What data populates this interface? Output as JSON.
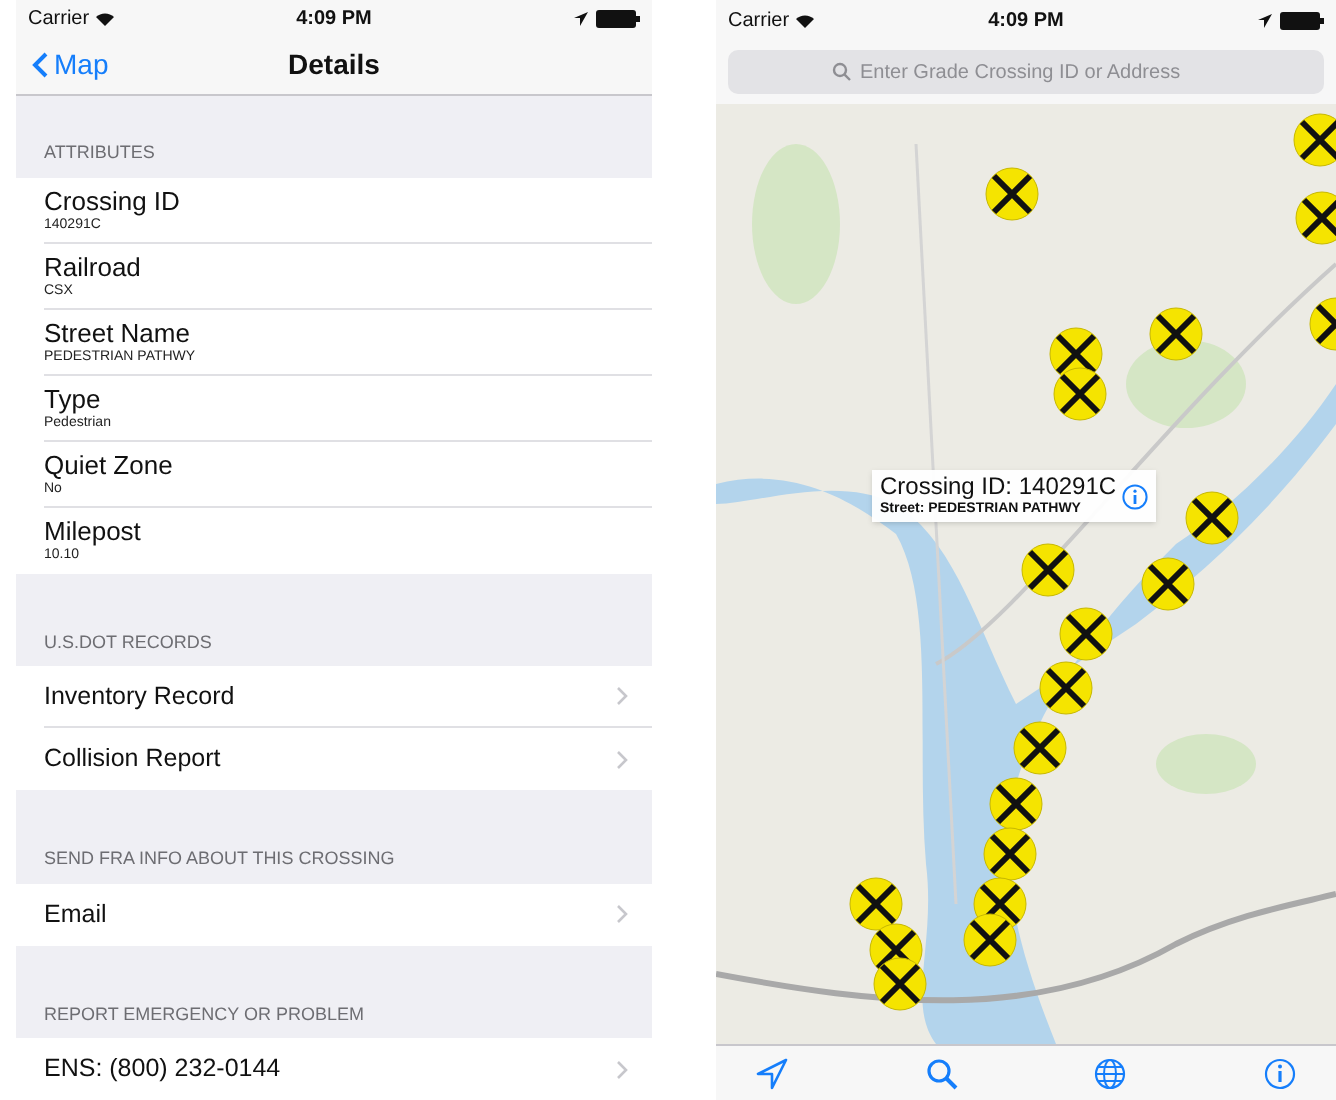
{
  "details_screen": {
    "status_bar": {
      "carrier": "Carrier",
      "time": "4:09 PM"
    },
    "nav": {
      "back": "Map",
      "title": "Details"
    },
    "sections": [
      {
        "header": "ATTRIBUTES",
        "kind": "fields",
        "rows": [
          {
            "label": "Crossing ID",
            "value": "140291C"
          },
          {
            "label": "Railroad",
            "value": "CSX"
          },
          {
            "label": "Street Name",
            "value": "PEDESTRIAN PATHWY"
          },
          {
            "label": "Type",
            "value": "Pedestrian"
          },
          {
            "label": "Quiet Zone",
            "value": "No"
          },
          {
            "label": "Milepost",
            "value": "10.10"
          }
        ]
      },
      {
        "header": "U.S.DOT RECORDS",
        "kind": "links",
        "rows": [
          {
            "label": "Inventory Record"
          },
          {
            "label": "Collision Report"
          }
        ]
      },
      {
        "header": "SEND FRA INFO ABOUT THIS CROSSING",
        "kind": "links",
        "rows": [
          {
            "label": "Email"
          }
        ]
      },
      {
        "header": "REPORT EMERGENCY OR PROBLEM",
        "kind": "links",
        "rows": [
          {
            "label": "ENS: (800) 232-0144"
          }
        ]
      }
    ]
  },
  "map_screen": {
    "status_bar": {
      "carrier": "Carrier",
      "time": "4:09 PM"
    },
    "search": {
      "placeholder": "Enter Grade Crossing ID or Address"
    },
    "callout": {
      "title": "Crossing ID: 140291C",
      "subtitle": "Street: PEDESTRIAN PATHWY"
    }
  }
}
